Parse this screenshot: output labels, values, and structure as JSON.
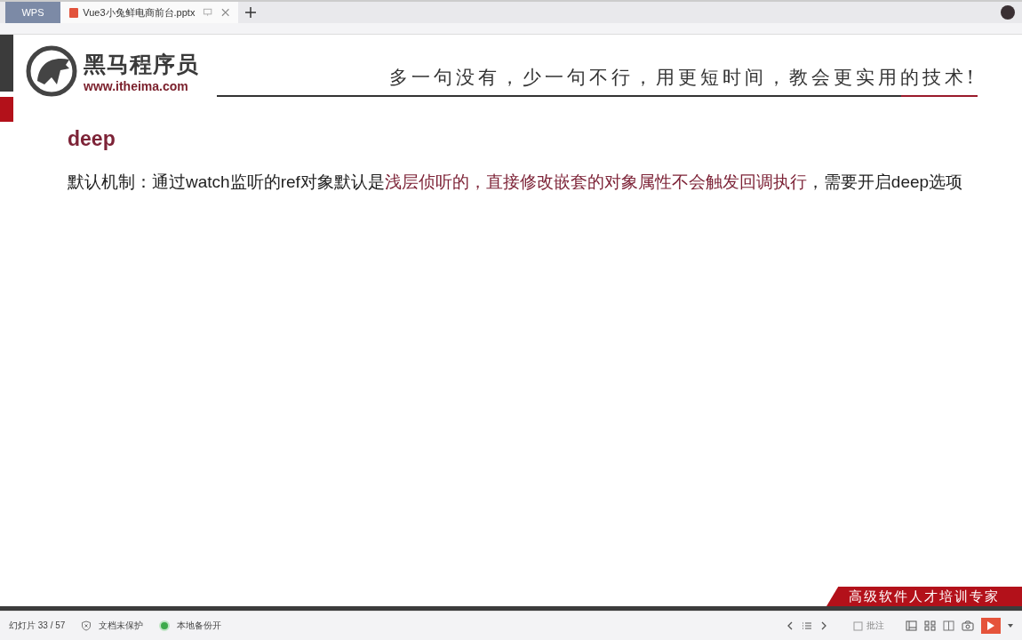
{
  "tabs": [
    {
      "label": "WPS",
      "selected": false
    },
    {
      "label": "Vue3小兔鲜电商前台.pptx",
      "selected": true
    }
  ],
  "slide": {
    "logo": {
      "name": "黑马程序员",
      "url": "www.itheima.com"
    },
    "slogan": "多一句没有，少一句不行，用更短时间，教会更实用的技术!",
    "title": "deep",
    "body": [
      {
        "text": "默认机制：通过watch监听的ref对象默认是",
        "emphasis": false
      },
      {
        "text": "浅层侦听的，直接修改嵌套的对象属性不会触发回调执行",
        "emphasis": true
      },
      {
        "text": "，需要开启deep选项",
        "emphasis": false
      }
    ],
    "banner": "高级软件人才培训专家"
  },
  "status_bar": {
    "slide_counter": "幻灯片 33 / 57",
    "protection": "文档未保护",
    "backup": "本地备份开",
    "annotate": "批注"
  }
}
